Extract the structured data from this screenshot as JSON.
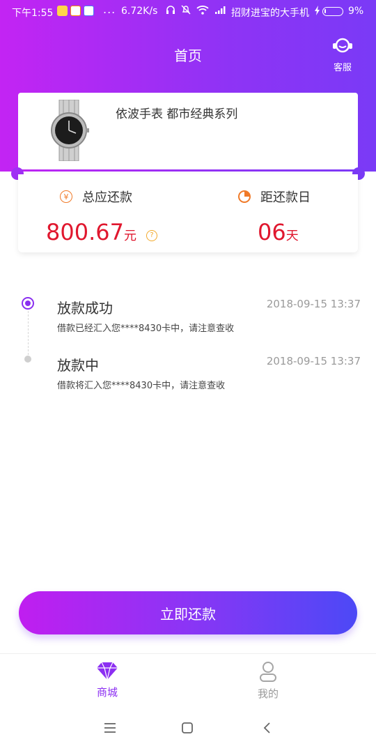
{
  "status_bar": {
    "time": "下午1:55",
    "network_speed": "6.72K/s",
    "carrier": "招财进宝的大手机",
    "battery_percent": "9%",
    "battery_level": 0.09,
    "more_dots": "..."
  },
  "header": {
    "title": "首页",
    "customer_service_label": "客服"
  },
  "product": {
    "name": "依波手表 都市经典系列",
    "image": "watch-image"
  },
  "loan_summary": {
    "total_label": "总应还款",
    "total_amount": "800.67",
    "total_unit": "元",
    "currency_symbol": "¥",
    "help_symbol": "?",
    "due_label": "距还款日",
    "due_days": "06",
    "due_unit": "天"
  },
  "timeline": [
    {
      "title": "放款成功",
      "time": "2018-09-15 13:37",
      "desc": "借款已经汇入您****8430卡中，请注意查收"
    },
    {
      "title": "放款中",
      "time": "2018-09-15 13:37",
      "desc": "借款将汇入您****8430卡中，请注意查收"
    }
  ],
  "actions": {
    "repay_now": "立即还款"
  },
  "tabbar": {
    "mall": "商城",
    "mine": "我的"
  },
  "colors": {
    "accent": "#8c2ff2",
    "amount_red": "#e0172e",
    "icon_orange": "#f07a28"
  }
}
